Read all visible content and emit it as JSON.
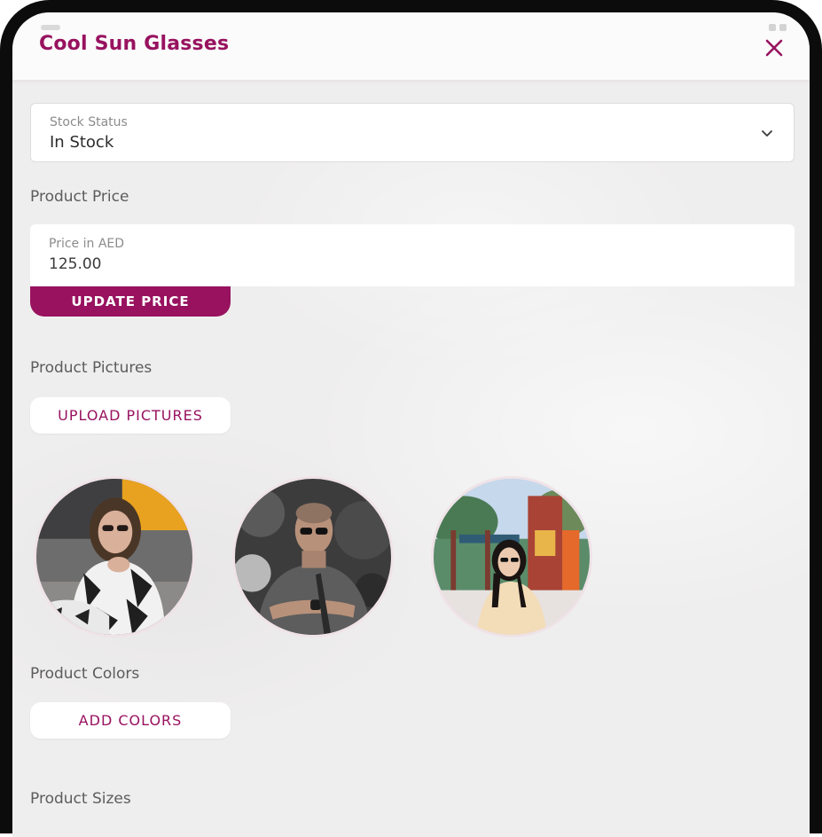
{
  "header": {
    "title": "Cool Sun Glasses",
    "close_icon": "close-icon"
  },
  "stock": {
    "label": "Stock Status",
    "value": "In Stock",
    "dropdown_icon": "chevron-down-icon"
  },
  "price": {
    "section_title": "Product Price",
    "field_label": "Price in AED",
    "field_value": "125.00",
    "update_button": "UPDATE PRICE"
  },
  "pictures": {
    "section_title": "Product Pictures",
    "upload_button": "UPLOAD PICTURES",
    "items": [
      {
        "name": "product-picture-1"
      },
      {
        "name": "product-picture-2"
      },
      {
        "name": "product-picture-3"
      }
    ]
  },
  "colors": {
    "section_title": "Product Colors",
    "add_button": "ADD COLORS"
  },
  "sizes": {
    "section_title": "Product Sizes"
  },
  "theme": {
    "accent": "#98125f",
    "background": "#efeeee",
    "surface": "#ffffff",
    "device_frame": "#0c0c0c"
  }
}
